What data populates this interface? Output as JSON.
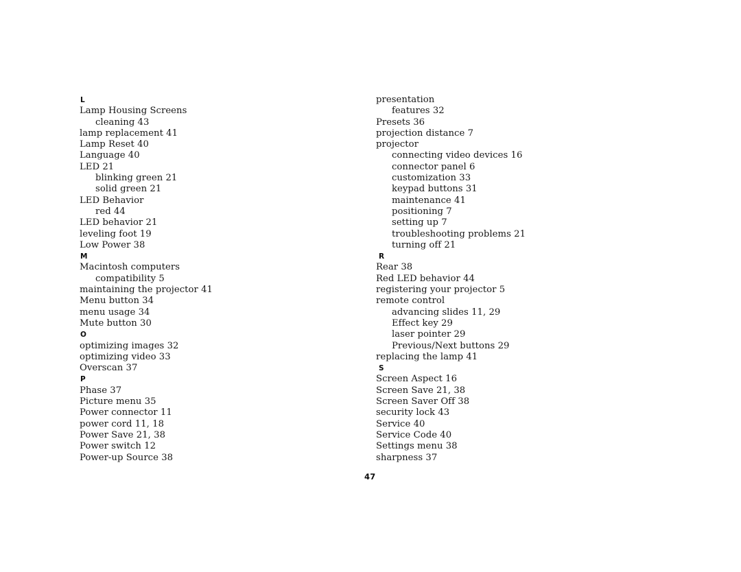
{
  "page": {
    "number": "47",
    "type": "index"
  },
  "columns": {
    "left": [
      {
        "kind": "letter",
        "text": "L"
      },
      {
        "kind": "entry",
        "level": 0,
        "text": "Lamp Housing Screens"
      },
      {
        "kind": "entry",
        "level": 1,
        "text": "cleaning 43"
      },
      {
        "kind": "entry",
        "level": 0,
        "text": "lamp replacement 41"
      },
      {
        "kind": "entry",
        "level": 0,
        "text": "Lamp Reset 40"
      },
      {
        "kind": "entry",
        "level": 0,
        "text": "Language 40"
      },
      {
        "kind": "entry",
        "level": 0,
        "text": "LED 21"
      },
      {
        "kind": "entry",
        "level": 1,
        "text": "blinking green 21"
      },
      {
        "kind": "entry",
        "level": 1,
        "text": "solid green 21"
      },
      {
        "kind": "entry",
        "level": 0,
        "text": "LED Behavior"
      },
      {
        "kind": "entry",
        "level": 1,
        "text": "red 44"
      },
      {
        "kind": "entry",
        "level": 0,
        "text": "LED behavior 21"
      },
      {
        "kind": "entry",
        "level": 0,
        "text": "leveling foot 19"
      },
      {
        "kind": "entry",
        "level": 0,
        "text": "Low Power 38"
      },
      {
        "kind": "letter",
        "text": "M"
      },
      {
        "kind": "entry",
        "level": 0,
        "text": "Macintosh computers"
      },
      {
        "kind": "entry",
        "level": 1,
        "text": "compatibility 5"
      },
      {
        "kind": "entry",
        "level": 0,
        "text": "maintaining the projector 41"
      },
      {
        "kind": "entry",
        "level": 0,
        "text": "Menu button 34"
      },
      {
        "kind": "entry",
        "level": 0,
        "text": "menu usage 34"
      },
      {
        "kind": "entry",
        "level": 0,
        "text": "Mute button 30"
      },
      {
        "kind": "letter",
        "text": "O"
      },
      {
        "kind": "entry",
        "level": 0,
        "text": "optimizing images 32"
      },
      {
        "kind": "entry",
        "level": 0,
        "text": "optimizing video 33"
      },
      {
        "kind": "entry",
        "level": 0,
        "text": "Overscan 37"
      },
      {
        "kind": "letter",
        "text": "P"
      },
      {
        "kind": "entry",
        "level": 0,
        "text": "Phase 37"
      },
      {
        "kind": "entry",
        "level": 0,
        "text": "Picture menu 35"
      },
      {
        "kind": "entry",
        "level": 0,
        "text": "Power connector 11"
      },
      {
        "kind": "entry",
        "level": 0,
        "text": "power cord 11, 18"
      },
      {
        "kind": "entry",
        "level": 0,
        "text": "Power Save 21, 38"
      },
      {
        "kind": "entry",
        "level": 0,
        "text": "Power switch 12"
      },
      {
        "kind": "entry",
        "level": 0,
        "text": "Power-up Source 38"
      }
    ],
    "right": [
      {
        "kind": "entry",
        "level": 0,
        "text": "presentation"
      },
      {
        "kind": "entry",
        "level": 1,
        "text": "features 32"
      },
      {
        "kind": "entry",
        "level": 0,
        "text": "Presets 36"
      },
      {
        "kind": "entry",
        "level": 0,
        "text": "projection distance 7"
      },
      {
        "kind": "entry",
        "level": 0,
        "text": "projector"
      },
      {
        "kind": "entry",
        "level": 1,
        "text": "connecting video devices 16"
      },
      {
        "kind": "entry",
        "level": 1,
        "text": "connector panel 6"
      },
      {
        "kind": "entry",
        "level": 1,
        "text": "customization 33"
      },
      {
        "kind": "entry",
        "level": 1,
        "text": "keypad buttons 31"
      },
      {
        "kind": "entry",
        "level": 1,
        "text": "maintenance 41"
      },
      {
        "kind": "entry",
        "level": 1,
        "text": "positioning 7"
      },
      {
        "kind": "entry",
        "level": 1,
        "text": "setting up 7"
      },
      {
        "kind": "entry",
        "level": 1,
        "text": "troubleshooting problems 21"
      },
      {
        "kind": "entry",
        "level": 1,
        "text": "turning off 21"
      },
      {
        "kind": "letter",
        "text": "R"
      },
      {
        "kind": "entry",
        "level": 0,
        "text": "Rear 38"
      },
      {
        "kind": "entry",
        "level": 0,
        "text": "Red LED behavior 44"
      },
      {
        "kind": "entry",
        "level": 0,
        "text": "registering your projector 5"
      },
      {
        "kind": "entry",
        "level": 0,
        "text": "remote control"
      },
      {
        "kind": "entry",
        "level": 1,
        "text": "advancing slides 11, 29"
      },
      {
        "kind": "entry",
        "level": 1,
        "text": "Effect key 29"
      },
      {
        "kind": "entry",
        "level": 1,
        "text": "laser pointer 29"
      },
      {
        "kind": "entry",
        "level": 1,
        "text": "Previous/Next buttons 29"
      },
      {
        "kind": "entry",
        "level": 0,
        "text": "replacing the lamp 41"
      },
      {
        "kind": "letter",
        "text": "S"
      },
      {
        "kind": "entry",
        "level": 0,
        "text": "Screen Aspect 16"
      },
      {
        "kind": "entry",
        "level": 0,
        "text": "Screen Save 21, 38"
      },
      {
        "kind": "entry",
        "level": 0,
        "text": "Screen Saver Off 38"
      },
      {
        "kind": "entry",
        "level": 0,
        "text": "security lock 43"
      },
      {
        "kind": "entry",
        "level": 0,
        "text": "Service 40"
      },
      {
        "kind": "entry",
        "level": 0,
        "text": "Service Code 40"
      },
      {
        "kind": "entry",
        "level": 0,
        "text": "Settings menu 38"
      },
      {
        "kind": "entry",
        "level": 0,
        "text": "sharpness 37"
      }
    ]
  }
}
